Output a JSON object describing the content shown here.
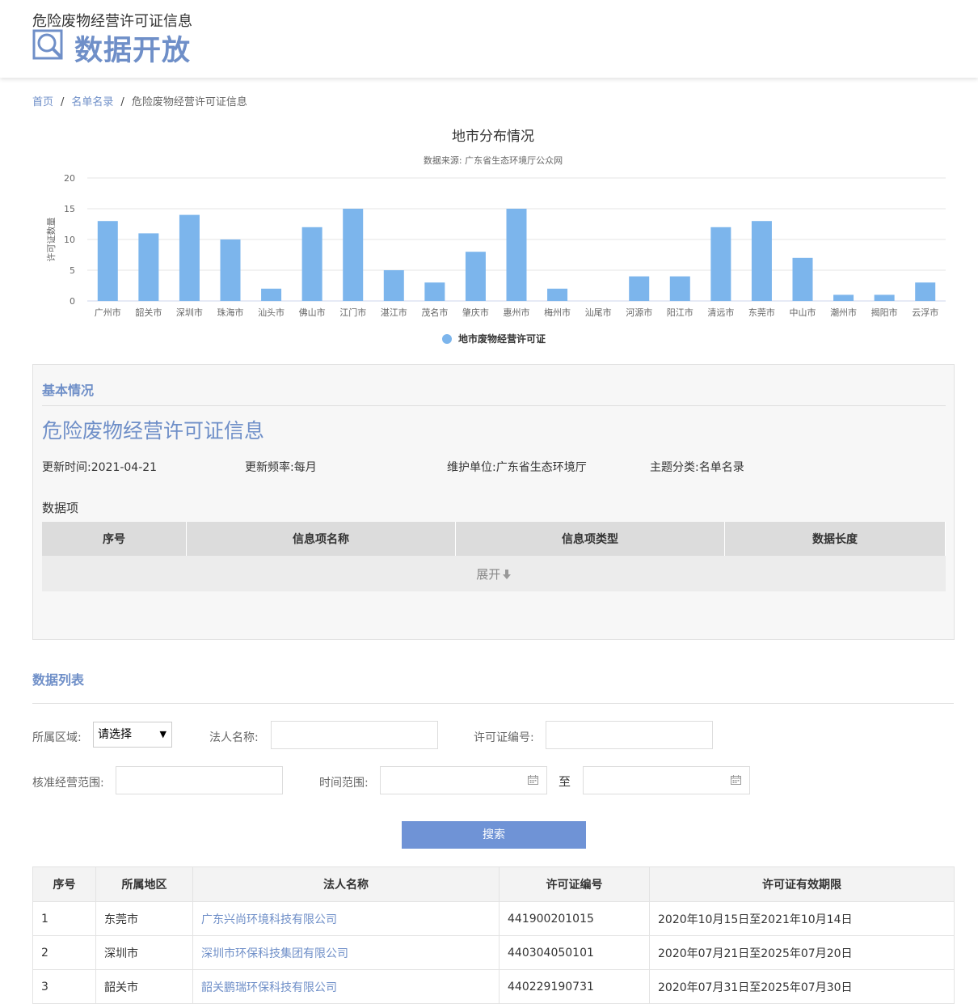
{
  "header": {
    "subtitle": "危险废物经营许可证信息",
    "title": "数据开放"
  },
  "breadcrumb": {
    "home": "首页",
    "list": "名单名录",
    "current": "危险废物经营许可证信息",
    "sep": "/"
  },
  "chart_data": {
    "type": "bar",
    "title": "地市分布情况",
    "subtitle": "数据来源: 广东省生态环境厅公众网",
    "ylabel": "许可证数量",
    "xlabel": "",
    "ylim": [
      0,
      20
    ],
    "yticks": [
      0,
      5,
      10,
      15,
      20
    ],
    "grid": true,
    "legend_position": "bottom-center",
    "color": "#7cb5ec",
    "categories": [
      "广州市",
      "韶关市",
      "深圳市",
      "珠海市",
      "汕头市",
      "佛山市",
      "江门市",
      "湛江市",
      "茂名市",
      "肇庆市",
      "惠州市",
      "梅州市",
      "汕尾市",
      "河源市",
      "阳江市",
      "清远市",
      "东莞市",
      "中山市",
      "潮州市",
      "揭阳市",
      "云浮市"
    ],
    "series": [
      {
        "name": "地市废物经营许可证",
        "values": [
          13,
          11,
          14,
          10,
          2,
          12,
          15,
          5,
          3,
          8,
          15,
          2,
          0,
          4,
          4,
          12,
          13,
          7,
          1,
          1,
          3
        ]
      }
    ]
  },
  "basic": {
    "heading": "基本情况",
    "title": "危险废物经营许可证信息",
    "update_time": "更新时间:2021-04-21",
    "frequency": "更新频率:每月",
    "maintainer": "维护单位:广东省生态环境厅",
    "category": "主题分类:名单名录",
    "items_label": "数据项",
    "columns": [
      "序号",
      "信息项名称",
      "信息项类型",
      "数据长度"
    ],
    "expand_label": "展开"
  },
  "filters": {
    "heading": "数据列表",
    "region_label": "所属区域:",
    "region_value": "请选择",
    "legal_label": "法人名称:",
    "license_label": "许可证编号:",
    "scope_label": "核准经营范围:",
    "time_label": "时间范围:",
    "to_label": "至",
    "search_label": "搜索"
  },
  "table": {
    "columns": [
      "序号",
      "所属地区",
      "法人名称",
      "许可证编号",
      "许可证有效期限"
    ],
    "rows": [
      [
        "1",
        "东莞市",
        "广东兴尚环境科技有限公司",
        "441900201015",
        "2020年10月15日至2021年10月14日"
      ],
      [
        "2",
        "深圳市",
        "深圳市环保科技集团有限公司",
        "440304050101",
        "2020年07月21日至2025年07月20日"
      ],
      [
        "3",
        "韶关市",
        "韶关鹏瑞环保科技有限公司",
        "440229190731",
        "2020年07月31日至2025年07月30日"
      ]
    ]
  }
}
